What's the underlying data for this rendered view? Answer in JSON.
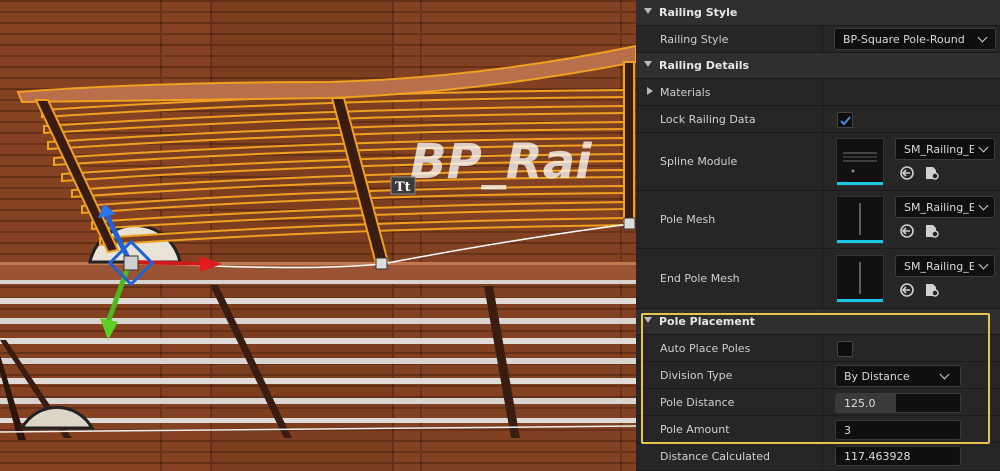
{
  "viewport": {
    "watermark_text": "BP_Rai",
    "text_actor_icon": "Tt"
  },
  "panel": {
    "railing_style_category": "Railing Style",
    "railing_style_label": "Railing Style",
    "railing_style_value": "BP-Square Pole-Round B",
    "railing_details_category": "Railing Details",
    "materials_label": "Materials",
    "lock_railing_label": "Lock Railing Data",
    "lock_railing_checked": true,
    "spline_module_label": "Spline Module",
    "spline_module_asset": "SM_Railing_E",
    "pole_mesh_label": "Pole Mesh",
    "pole_mesh_asset": "SM_Railing_E",
    "end_pole_mesh_label": "End Pole Mesh",
    "end_pole_mesh_asset": "SM_Railing_E",
    "pole_placement_category": "Pole Placement",
    "auto_place_label": "Auto Place Poles",
    "auto_place_checked": false,
    "division_type_label": "Division Type",
    "division_type_value": "By Distance",
    "pole_distance_label": "Pole Distance",
    "pole_distance_value": "125.0",
    "pole_amount_label": "Pole Amount",
    "pole_amount_value": "3",
    "distance_calc_label": "Distance Calculated",
    "distance_calc_value": "117.463928"
  },
  "colors": {
    "selection_outline": "#f0a020",
    "highlight_box": "#e8c34d",
    "checkbox_accent": "#2d7fd6",
    "thumbnail_bar": "#19c6e6"
  },
  "icons": [
    "dropdown-chevron-icon",
    "checkmark-icon",
    "browse-asset-icon",
    "use-selected-asset-icon",
    "expand-arrow-icon",
    "collapse-arrow-icon",
    "transform-gizmo-icon",
    "text-actor-icon"
  ]
}
